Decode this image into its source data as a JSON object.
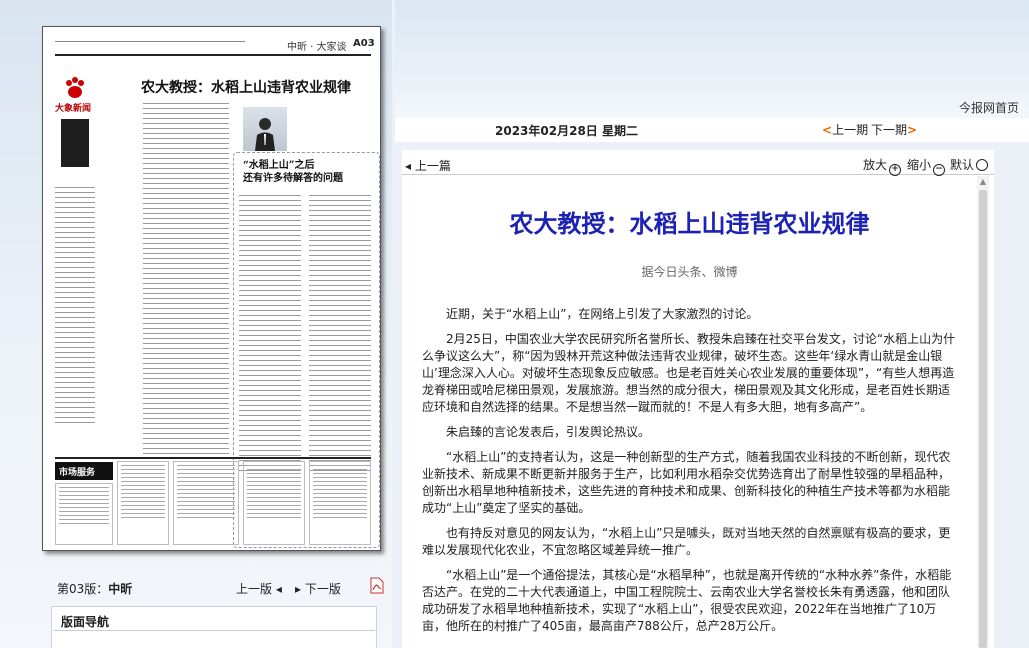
{
  "paper_thumb": {
    "header_name": "中昕 · 大家谈",
    "header_page": "A03",
    "headline": "农大教授：水稻上山违背农业规律",
    "logo_text": "大象新闻",
    "sidebar_title_1": "“水稻上山”之后",
    "sidebar_title_2": "还有许多待解答的问题",
    "ad_badge": "市场服务"
  },
  "edition": {
    "page_prefix": "第03版：",
    "page_name": "中昕",
    "prev_edition": "上一版",
    "next_edition": "下一版",
    "toc_title": "版面导航"
  },
  "header": {
    "home_link": "今报网首页",
    "date": "2023年02月28日 星期二",
    "prev_day": "上一期",
    "next_day": "下一期"
  },
  "toolbar": {
    "prev_article": "上一篇",
    "zoom_in": "放大",
    "zoom_out": "缩小",
    "zoom_default": "默认"
  },
  "icons": {
    "prev_arrow": "caret-left-icon",
    "next_arrow": "caret-right-icon",
    "pdf": "pdf-icon",
    "zoom_in": "plus-circle-icon",
    "zoom_out": "minus-circle-icon",
    "zoom_default": "circle-icon"
  },
  "colors": {
    "title": "#1c22b4",
    "bracket": "#e06a00"
  },
  "article": {
    "title": "农大教授：水稻上山违背农业规律",
    "source": "据今日头条、微博",
    "paragraphs": [
      "近期，关于“水稻上山”，在网络上引发了大家激烈的讨论。",
      "2月25日，中国农业大学农民研究所名誉所长、教授朱启臻在社交平台发文，讨论“水稻上山为什么争议这么大”，称“因为毁林开荒这种做法违背农业规律，破坏生态。这些年‘绿水青山就是金山银山’理念深入人心。对破坏生态现象反应敏感。也是老百姓关心农业发展的重要体现”，“有些人想再造龙脊梯田或哈尼梯田景观，发展旅游。想当然的成分很大，梯田景观及其文化形成，是老百姓长期适应环境和自然选择的结果。不是想当然一蹴而就的！不是人有多大胆，地有多高产”。",
      "朱启臻的言论发表后，引发舆论热议。",
      "“水稻上山”的支持者认为，这是一种创新型的生产方式，随着我国农业科技的不断创新，现代农业新技术、新成果不断更新并服务于生产，比如利用水稻杂交优势选育出了耐旱性较强的旱稻品种，创新出水稻旱地种植新技术，这些先进的育种技术和成果、创新科技化的种植生产技术等都为水稻能成功“上山”奠定了坚实的基础。",
      "也有持反对意见的网友认为，“水稻上山”只是噱头，既对当地天然的自然禀赋有极高的要求，更难以发展现代化农业，不宜忽略区域差异统一推广。",
      "“水稻上山”是一个通俗提法，其核心是“水稻旱种”，也就是离开传统的“水种水养”条件，水稻能否达产。在党的二十大代表通道上，中国工程院院士、云南农业大学名誉校长朱有勇透露，他和团队成功研发了水稻旱地种植新技术，实现了“水稻上山”，很受农民欢迎，2022年在当地推广了10万亩，他所在的村推广了405亩，最高亩产788公斤，总产28万公斤。"
    ]
  }
}
